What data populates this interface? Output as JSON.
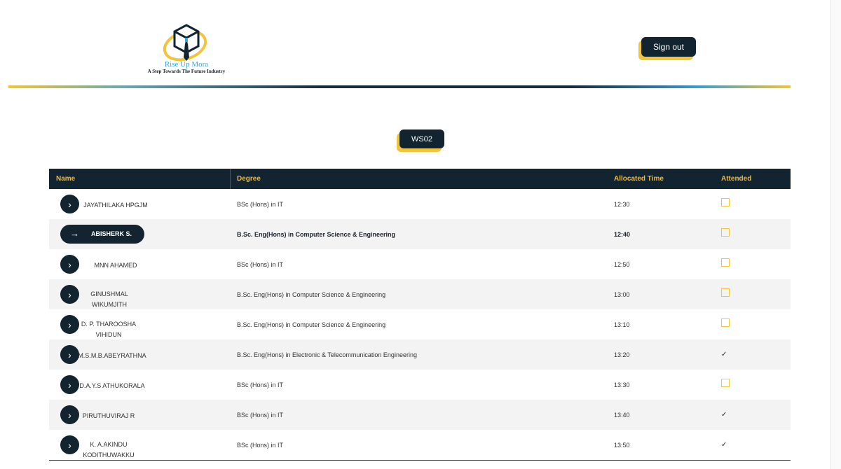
{
  "header": {
    "logo_title": "Rise Up Mora",
    "logo_tagline": "A Step Towards The Future Industry",
    "signout_label": "Sign out"
  },
  "workshop": {
    "label": "WS02"
  },
  "table": {
    "columns": {
      "name": "Name",
      "degree": "Degree",
      "time": "Allocated Time",
      "attended": "Attended"
    },
    "rows": [
      {
        "name": "JAYATHILAKA HPGJM",
        "degree": "BSc (Hons) in IT",
        "time": "12:30",
        "attended": false,
        "attended_text": ""
      },
      {
        "name": "ABISHERK S.",
        "degree": "B.Sc. Eng(Hons) in Computer Science & Engineering",
        "time": "12:40",
        "attended": false,
        "attended_text": ""
      },
      {
        "name": "MNN AHAMED",
        "degree": "BSc (Hons) in IT",
        "time": "12:50",
        "attended": false,
        "attended_text": ""
      },
      {
        "name": "GINUSHMAL WIKUMJITH",
        "degree": "B.Sc. Eng(Hons) in Computer Science & Engineering",
        "time": "13:00",
        "attended": false,
        "attended_text": ""
      },
      {
        "name": "D. P. THAROOSHA VIHIDUN",
        "degree": "B.Sc. Eng(Hons) in Computer Science & Engineering",
        "time": "13:10",
        "attended": false,
        "attended_text": ""
      },
      {
        "name": "M.S.M.B.ABEYRATHNA",
        "degree": "B.Sc. Eng(Hons) in Electronic & Telecommunication Engineering",
        "time": "13:20",
        "attended": true,
        "attended_text": "✓"
      },
      {
        "name": "D.A.Y.S ATHUKORALA",
        "degree": "BSc (Hons) in IT",
        "time": "13:30",
        "attended": false,
        "attended_text": ""
      },
      {
        "name": "PIRUTHUVIRAJ R",
        "degree": "BSc (Hons) in IT",
        "time": "13:40",
        "attended": true,
        "attended_text": "✓"
      },
      {
        "name": "K. A.AKINDU KODITHUWAKKU",
        "degree": "BSc (Hons) in IT",
        "time": "13:50",
        "attended": true,
        "attended_text": "✓"
      }
    ]
  },
  "colors": {
    "dark": "#12242f",
    "accent_yellow": "#f0c53a",
    "header_text": "#f5b82e",
    "row_alt": "#f3f3f3",
    "logo_blue": "#3aa3d8"
  },
  "icons": {
    "row_action": "chevron-right-icon",
    "active_row_action": "arrow-right-icon",
    "attended": "check-icon",
    "not_attended": "empty-checkbox-icon"
  }
}
